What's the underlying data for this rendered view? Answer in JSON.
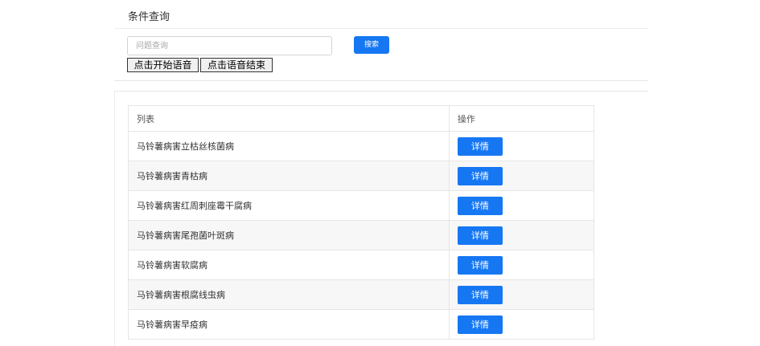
{
  "query_panel": {
    "title": "条件查询",
    "search_placeholder": "问题查询",
    "search_value": "",
    "search_button": "搜索",
    "voice_start_button": "点击开始语音",
    "voice_end_button": "点击语音结束"
  },
  "list_panel": {
    "columns": [
      "列表",
      "操作"
    ],
    "rows": [
      {
        "name": "马铃薯病害立枯丝核菌病",
        "action": "详情"
      },
      {
        "name": "马铃薯病害青枯病",
        "action": "详情"
      },
      {
        "name": "马铃薯病害红周刺座霉干腐病",
        "action": "详情"
      },
      {
        "name": "马铃薯病害尾孢菌叶斑病",
        "action": "详情"
      },
      {
        "name": "马铃薯病害软腐病",
        "action": "详情"
      },
      {
        "name": "马铃薯病害根腐线虫病",
        "action": "详情"
      },
      {
        "name": "马铃薯病害早疫病",
        "action": "详情"
      }
    ]
  },
  "colors": {
    "primary": "#1677f3",
    "border": "#e6e6e6",
    "stripe": "#f7f7f7"
  }
}
